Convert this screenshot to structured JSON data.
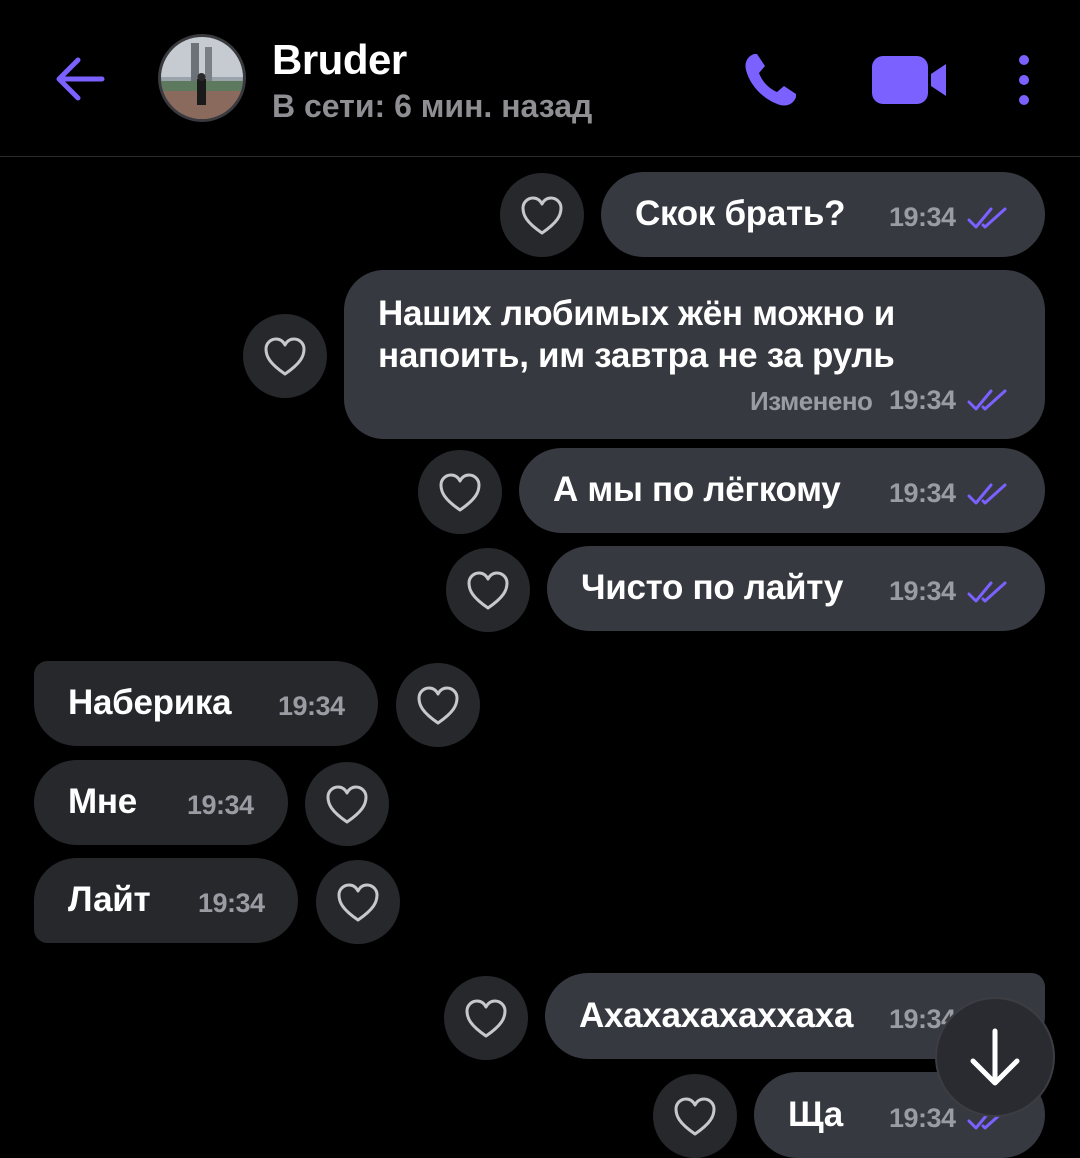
{
  "header": {
    "contact_name": "Bruder",
    "status": "В сети: 6 мин. назад",
    "icons": [
      "back-arrow-icon",
      "phone-icon",
      "video-camera-icon",
      "more-vertical-icon"
    ],
    "accent_color": "#7b61ff"
  },
  "messages": [
    {
      "direction": "out",
      "text": "Скок брать?",
      "time": "19:34",
      "read": true
    },
    {
      "direction": "out",
      "text_lines": [
        "Наших любимых жён можно и",
        "напоить, им завтра не за руль"
      ],
      "edited_label": "Изменено",
      "time": "19:34",
      "read": true
    },
    {
      "direction": "out",
      "text": "А мы по лёгкому",
      "time": "19:34",
      "read": true
    },
    {
      "direction": "out",
      "text": "Чисто по лайту",
      "time": "19:34",
      "read": true
    },
    {
      "direction": "in",
      "text": "Наберика",
      "time": "19:34"
    },
    {
      "direction": "in",
      "text": "Мне",
      "time": "19:34"
    },
    {
      "direction": "in",
      "text": "Лайт",
      "time": "19:34"
    },
    {
      "direction": "out",
      "text": "Ахахахахаххаха",
      "time": "19:34",
      "read": true
    },
    {
      "direction": "out",
      "text": "Ща",
      "time": "19:34",
      "read": true
    }
  ],
  "colors": {
    "background": "#000000",
    "outgoing_bubble": "#363940",
    "incoming_bubble": "#26282c",
    "read_ticks": "#7b61ff"
  }
}
